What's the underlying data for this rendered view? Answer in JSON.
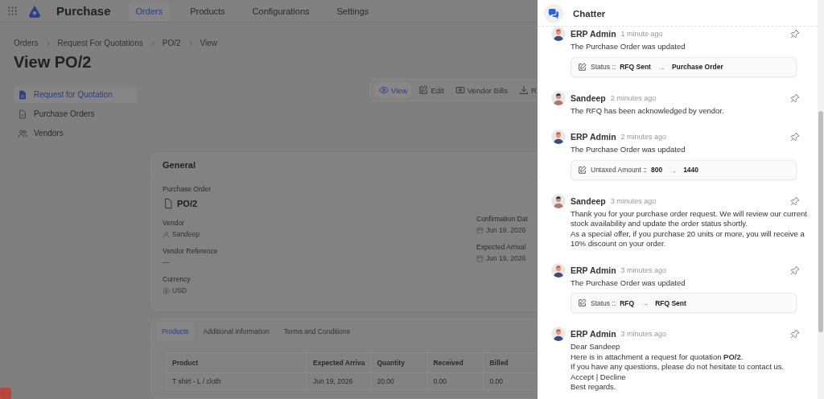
{
  "nav": {
    "app_title": "Purchase",
    "items": [
      {
        "label": "Orders",
        "selected": true
      },
      {
        "label": "Products",
        "selected": false
      },
      {
        "label": "Configurations",
        "selected": false
      },
      {
        "label": "Settings",
        "selected": false
      }
    ]
  },
  "breadcrumb": [
    "Orders",
    "Request For Quotations",
    "PO/2",
    "View"
  ],
  "page_title": "View PO/2",
  "sidebar": {
    "items": [
      {
        "label": "Request for Quotation",
        "selected": true
      },
      {
        "label": "Purchase Orders",
        "selected": false
      },
      {
        "label": "Vendors",
        "selected": false
      }
    ]
  },
  "actions": [
    {
      "label": "View",
      "selected": true
    },
    {
      "label": "Edit",
      "selected": false
    },
    {
      "label": "Vendor Bills",
      "selected": false
    },
    {
      "label": "R",
      "selected": false
    }
  ],
  "general": {
    "title": "General",
    "record_label": "Purchase Order",
    "record_value": "PO/2",
    "left_fields": [
      {
        "label": "Vendor",
        "value": "Sandeep"
      },
      {
        "label": "Vendor Reference",
        "value": "—"
      },
      {
        "label": "Currency",
        "value": "USD"
      }
    ],
    "right_fields": [
      {
        "label": "Confirmation Dat",
        "value": "Jun 19, 2026"
      },
      {
        "label": "Expected Arrival",
        "value": "Jun 19, 2026"
      }
    ]
  },
  "tabs": [
    {
      "label": "Products",
      "selected": true
    },
    {
      "label": "Additional Information",
      "selected": false
    },
    {
      "label": "Terms and Conditions",
      "selected": false
    }
  ],
  "table": {
    "columns": [
      "Product",
      "Expected Arriva",
      "Quantity",
      "Received",
      "Billed"
    ],
    "rows": [
      [
        "T shirt - L / cloth",
        "Jun 19, 2026",
        "20.00",
        "0.00",
        "0.00"
      ]
    ]
  },
  "chatter": {
    "title": "Chatter",
    "messages": [
      {
        "author": "ERP Admin",
        "kind": "admin",
        "time": "1 minute ago",
        "lines": [
          "The Purchase Order was updated"
        ],
        "change": {
          "label": "Status ::",
          "from": "RFQ Sent",
          "arrow": "→",
          "to": "Purchase Order"
        }
      },
      {
        "author": "Sandeep",
        "kind": "vendor",
        "time": "2 minutes ago",
        "lines": [
          "The RFQ has been acknowledged by vendor."
        ]
      },
      {
        "author": "ERP Admin",
        "kind": "admin",
        "time": "2 minutes ago",
        "lines": [
          "The Purchase Order was updated"
        ],
        "change": {
          "label": "Untaxed Amount ::",
          "from": "800",
          "arrow": "→",
          "to": "1440"
        }
      },
      {
        "author": "Sandeep",
        "kind": "vendor",
        "time": "3 minutes ago",
        "lines": [
          "Thank you for your purchase order request. We will review our current stock availability and update the order status shortly.",
          "As a special offer, if you purchase 20 units or more, you will receive a 10% discount on your order."
        ]
      },
      {
        "author": "ERP Admin",
        "kind": "admin",
        "time": "3 minutes ago",
        "lines": [
          "The Purchase Order was updated"
        ],
        "change": {
          "label": "Status ::",
          "from": "RFQ",
          "arrow": "→",
          "to": "RFQ Sent"
        }
      },
      {
        "author": "ERP Admin",
        "kind": "admin",
        "time": "3 minutes ago",
        "lines": [
          "Dear Sandeep",
          "Here is in attachment a request for quotation **PO/2**.",
          "If you have any questions, please do not hesitate to contact us.",
          "Accept | Decline",
          "Best regards."
        ]
      }
    ]
  }
}
